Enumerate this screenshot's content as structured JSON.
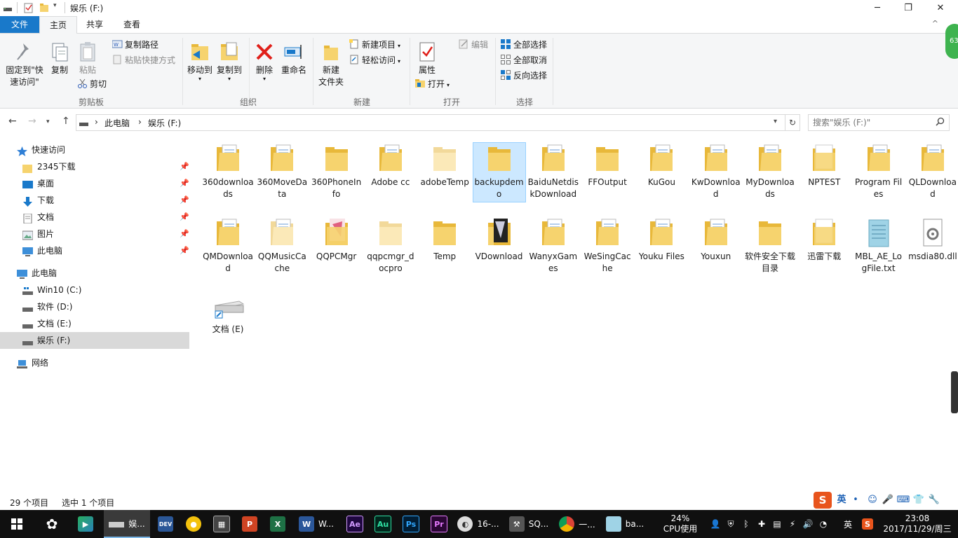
{
  "window": {
    "title": "娱乐 (F:)",
    "controls": {
      "minimize": "─",
      "maximize": "❐",
      "close": "✕"
    }
  },
  "ribbon": {
    "tabs": [
      "文件",
      "主页",
      "共享",
      "查看"
    ],
    "collapse_icon": "^",
    "clipboard": {
      "pin_label_1": "固定到\"快",
      "pin_label_2": "速访问\"",
      "copy": "复制",
      "paste": "粘贴",
      "copy_path": "复制路径",
      "paste_shortcut": "粘贴快捷方式",
      "cut": "剪切",
      "group": "剪贴板"
    },
    "organize": {
      "move_to": "移动到",
      "copy_to": "复制到",
      "delete": "删除",
      "rename": "重命名",
      "group": "组织"
    },
    "new": {
      "new_folder_1": "新建",
      "new_folder_2": "文件夹",
      "new_item": "新建项目",
      "easy_access": "轻松访问",
      "group": "新建"
    },
    "open": {
      "properties": "属性",
      "open": "打开",
      "edit": "编辑",
      "group": "打开"
    },
    "select": {
      "select_all": "全部选择",
      "select_none": "全部取消",
      "invert": "反向选择",
      "group": "选择"
    },
    "badge": "63"
  },
  "address": {
    "crumbs": [
      "此电脑",
      "娱乐 (F:)"
    ],
    "separator": "›",
    "search_placeholder": "搜索\"娱乐 (F:)\""
  },
  "nav": {
    "quick_access": "快速访问",
    "quick_items": [
      "2345下载",
      "桌面",
      "下载",
      "文档",
      "图片",
      "此电脑"
    ],
    "this_pc": "此电脑",
    "drives": [
      "Win10 (C:)",
      "软件 (D:)",
      "文档 (E:)",
      "娱乐 (F:)"
    ],
    "network": "网络"
  },
  "files": [
    {
      "name": "360downloads",
      "kind": "folder-docs"
    },
    {
      "name": "360MoveData",
      "kind": "folder-docs"
    },
    {
      "name": "360PhoneInfo",
      "kind": "folder"
    },
    {
      "name": "Adobe cc",
      "kind": "folder-docs"
    },
    {
      "name": "adobeTemp",
      "kind": "folder-light"
    },
    {
      "name": "backupdemo",
      "kind": "folder",
      "selected": true
    },
    {
      "name": "BaiduNetdiskDownload",
      "kind": "folder-docs"
    },
    {
      "name": "FFOutput",
      "kind": "folder"
    },
    {
      "name": "KuGou",
      "kind": "folder-docs"
    },
    {
      "name": "KwDownload",
      "kind": "folder-docs"
    },
    {
      "name": "MyDownloads",
      "kind": "folder-docs"
    },
    {
      "name": "NPTEST",
      "kind": "folder-white"
    },
    {
      "name": "Program Files",
      "kind": "folder-docs"
    },
    {
      "name": "QLDownload",
      "kind": "folder-docs"
    },
    {
      "name": "QMDownload",
      "kind": "folder-docs"
    },
    {
      "name": "QQMusicCache",
      "kind": "folder-light-docs"
    },
    {
      "name": "QQPCMgr",
      "kind": "folder-image"
    },
    {
      "name": "qqpcmgr_docpro",
      "kind": "folder-light"
    },
    {
      "name": "Temp",
      "kind": "folder"
    },
    {
      "name": "VDownload",
      "kind": "folder-dark"
    },
    {
      "name": "WanyxGames",
      "kind": "folder-docs"
    },
    {
      "name": "WeSingCache",
      "kind": "folder-docs"
    },
    {
      "name": "Youku Files",
      "kind": "folder-docs"
    },
    {
      "name": "Youxun",
      "kind": "folder-docs"
    },
    {
      "name": "软件安全下载目录",
      "kind": "folder"
    },
    {
      "name": "迅雷下载",
      "kind": "folder-white"
    },
    {
      "name": "MBL_AE_LogFile.txt",
      "kind": "text-file"
    },
    {
      "name": "msdia80.dll",
      "kind": "dll-file"
    },
    {
      "name": "文档 (E)",
      "kind": "drive-shortcut"
    }
  ],
  "status": {
    "count": "29 个项目",
    "selected": "选中 1 个项目"
  },
  "taskbar": {
    "explorer_label": "娱...",
    "app16_label": "16-...",
    "sql_label": "SQ...",
    "chrome_label": "一...",
    "ba_label": "ba...",
    "cpu_percent": "24%",
    "cpu_label": "CPU使用",
    "ime_lang": "英",
    "time": "23:08",
    "date": "2017/11/29/周三",
    "icons": {
      "dev": "DEV",
      "ppt": "P",
      "excel": "X",
      "word": "W",
      "word_label": "W...",
      "ae": "Ae",
      "au": "Au",
      "ps": "Ps",
      "pr": "Pr"
    }
  },
  "ime": {
    "lang": "英",
    "dot": "•",
    "symbols": [
      "☺",
      "🎤",
      "⌨",
      "👕",
      "🔧"
    ]
  },
  "colors": {
    "accent": "#1979ca",
    "selection": "#cce8ff",
    "folder": "#f6d36e",
    "taskbar": "#101010"
  }
}
